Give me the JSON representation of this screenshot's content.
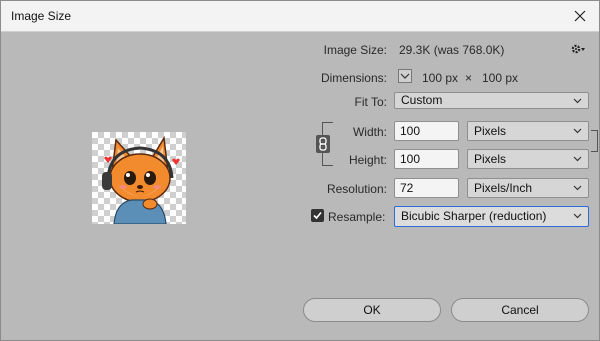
{
  "window": {
    "title": "Image Size"
  },
  "image_size": {
    "label": "Image Size:",
    "value": "29.3K (was 768.0K)"
  },
  "dimensions": {
    "label": "Dimensions:",
    "width": "100 px",
    "times": "×",
    "height": "100 px"
  },
  "fit_to": {
    "label": "Fit To:",
    "selected": "Custom"
  },
  "width": {
    "label": "Width:",
    "value": "100",
    "unit": "Pixels"
  },
  "height": {
    "label": "Height:",
    "value": "100",
    "unit": "Pixels"
  },
  "resolution": {
    "label": "Resolution:",
    "value": "72",
    "unit": "Pixels/Inch"
  },
  "resample": {
    "label": "Resample:",
    "checked": true,
    "method": "Bicubic Sharper (reduction)"
  },
  "buttons": {
    "ok": "OK",
    "cancel": "Cancel"
  },
  "colors": {
    "accent": "#2d6bd6",
    "dialog_bg": "#b9b9b9",
    "titlebar_bg": "#f3f3f3"
  },
  "icons": {
    "close": "close-icon",
    "settings": "gear-icon",
    "link": "link-icon",
    "dropdown": "chevron-down-icon",
    "check": "checkbox-checked-icon"
  }
}
